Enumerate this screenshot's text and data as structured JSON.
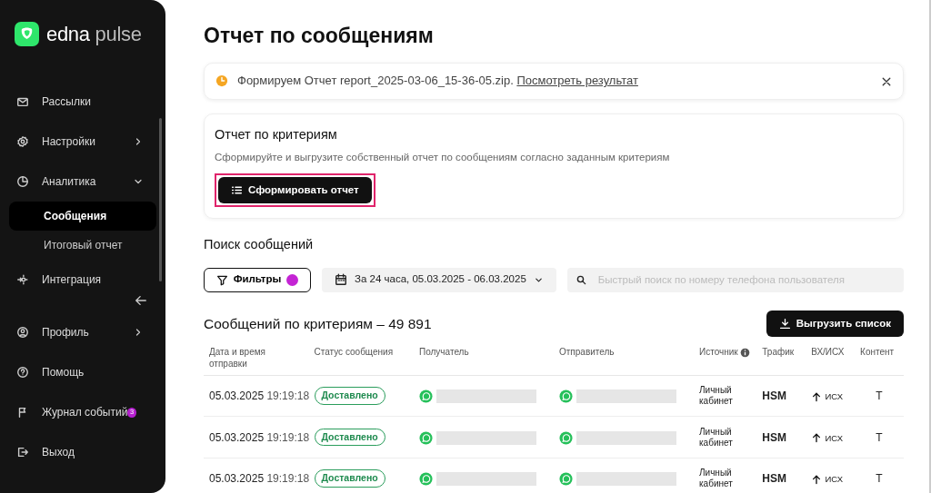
{
  "logo": {
    "primary": "edna",
    "secondary": "pulse"
  },
  "sidebar": {
    "items": [
      {
        "label": "Рассылки",
        "submenu": false
      },
      {
        "label": "Настройки",
        "submenu": true
      },
      {
        "label": "Аналитика",
        "submenu": true,
        "expanded": true,
        "children": [
          {
            "label": "Сообщения",
            "selected": true
          },
          {
            "label": "Итоговый отчет",
            "selected": false
          }
        ]
      },
      {
        "label": "Интеграция",
        "submenu": false
      }
    ],
    "bottom_items": [
      {
        "label": "Профиль",
        "submenu": true
      },
      {
        "label": "Помощь",
        "submenu": false
      },
      {
        "label": "Журнал событий",
        "submenu": false,
        "badge": "3"
      },
      {
        "label": "Выход",
        "submenu": false
      }
    ]
  },
  "title": "Отчет по сообщениям",
  "notice": {
    "text": "Формируем Отчет report_2025-03-06_15-36-05.zip.",
    "link": "Посмотреть результат"
  },
  "report_card": {
    "title": "Отчет по критериям",
    "description": "Сформируйте и выгрузите собственный отчет по сообщениям согласно заданным критериям",
    "button": "Сформировать отчет",
    "highlighted": true
  },
  "search_title": "Поиск сообщений",
  "filters": {
    "button": "Фильтры",
    "active": true,
    "date_range": "За 24 часа, 05.03.2025 - 06.03.2025",
    "search_placeholder": "Быстрый поиск по номеру телефона пользователя"
  },
  "results": {
    "title": "Сообщений по критериям – 49 891",
    "export_button": "Выгрузить список"
  },
  "table": {
    "columns": [
      {
        "label": "Дата и время отправки"
      },
      {
        "label": "Статус сообщения"
      },
      {
        "label": "Получатель"
      },
      {
        "label": "Отправитель"
      },
      {
        "label": "Источник",
        "info": true
      },
      {
        "label": "Трафик"
      },
      {
        "label": "ВХ/ИСХ"
      },
      {
        "label": "Контент"
      }
    ],
    "rows": [
      {
        "date": "05.03.2025",
        "time": "19:19:18",
        "status": "Доставлено",
        "source": "Личный кабинет",
        "traffic": "HSM",
        "direction": "ИСХ",
        "content": "T"
      },
      {
        "date": "05.03.2025",
        "time": "19:19:18",
        "status": "Доставлено",
        "source": "Личный кабинет",
        "traffic": "HSM",
        "direction": "ИСХ",
        "content": "T"
      },
      {
        "date": "05.03.2025",
        "time": "19:19:18",
        "status": "Доставлено",
        "source": "Личный кабинет",
        "traffic": "HSM",
        "direction": "ИСХ",
        "content": "T"
      }
    ]
  }
}
